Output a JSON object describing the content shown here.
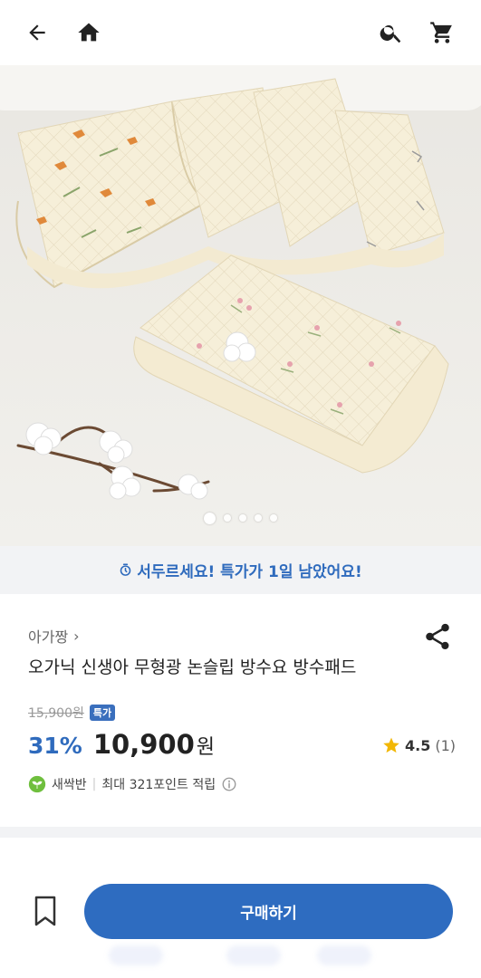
{
  "topbar": {
    "back_icon": "arrow-left-icon",
    "home_icon": "home-icon",
    "search_icon": "search-icon",
    "cart_icon": "cart-icon"
  },
  "gallery": {
    "image_count": 5,
    "active_index": 0
  },
  "sale_banner": {
    "icon": "clock-icon",
    "text": "서두르세요! 특가가 1일 남았어요!"
  },
  "product": {
    "brand": "아가짱",
    "brand_chevron": "›",
    "title": "오가닉 신생아 무형광 논슬립 방수요 방수패드",
    "original_price": "15,900원",
    "badge": "특가",
    "discount": "31%",
    "price": "10,900",
    "currency": "원",
    "rating_score": "4.5",
    "rating_count": "(1)",
    "member_grade": "새싹반",
    "points_text": "최대 321포인트 적립"
  },
  "actions": {
    "buy_label": "구매하기"
  },
  "colors": {
    "accent": "#2e6cc0",
    "banner_text": "#2f6bbd",
    "star": "#f2b705",
    "banner_bg": "#f2f3f5"
  }
}
